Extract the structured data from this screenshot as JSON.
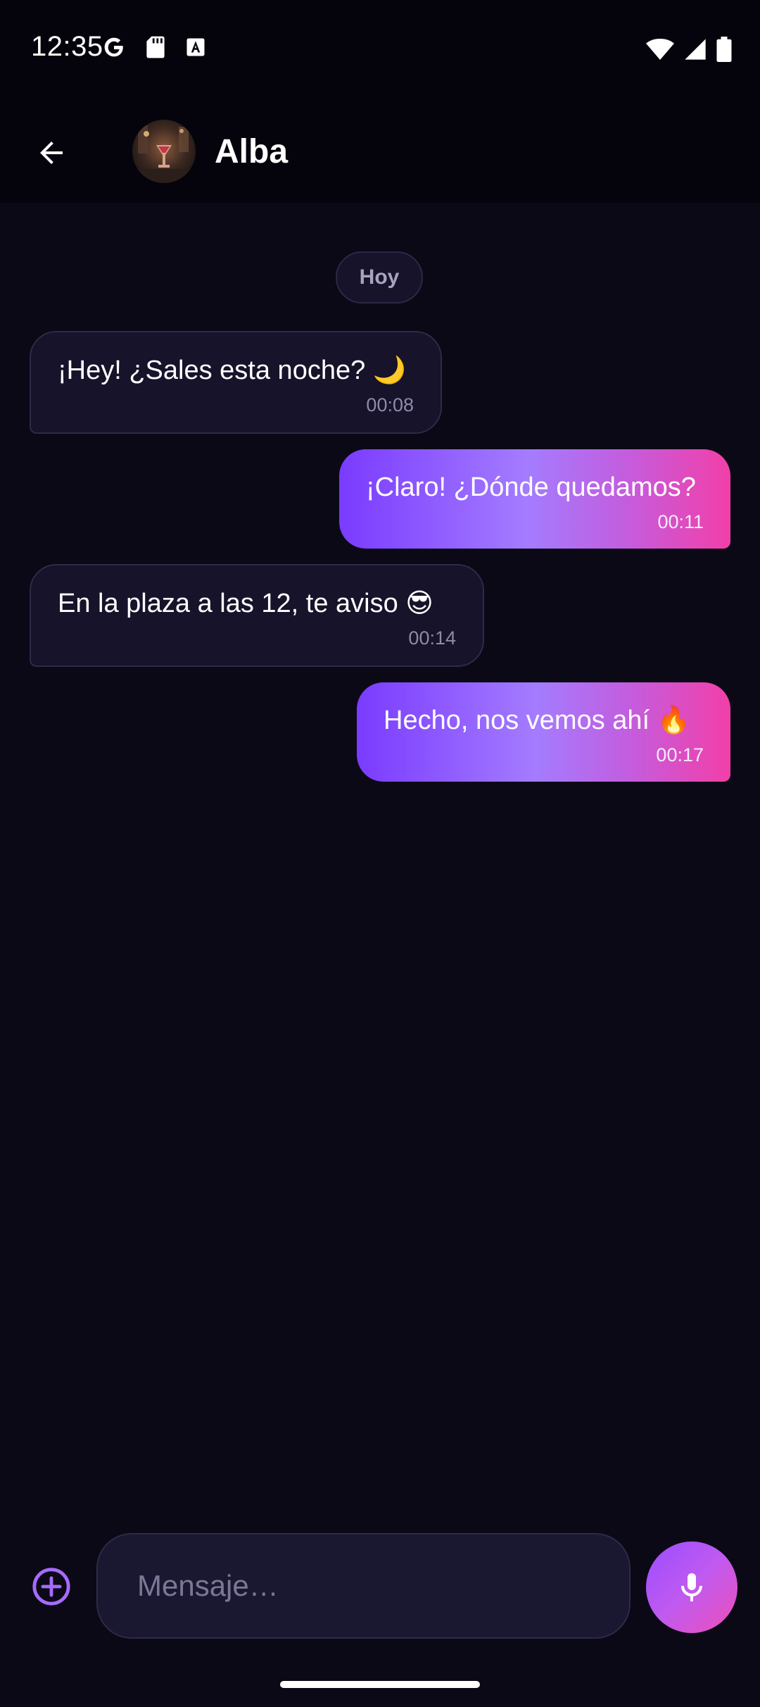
{
  "status_bar": {
    "time": "12:35",
    "left_icons": [
      "google-icon",
      "sd-card-icon",
      "font-icon"
    ],
    "right_icons": [
      "wifi-icon",
      "signal-icon",
      "battery-icon"
    ]
  },
  "header": {
    "back_icon": "arrow-back-icon",
    "contact_name": "Alba"
  },
  "chat": {
    "date_label": "Hoy",
    "messages": [
      {
        "direction": "incoming",
        "text": "¡Hey! ¿Sales esta noche? 🌙",
        "time": "00:08"
      },
      {
        "direction": "outgoing",
        "text": "¡Claro! ¿Dónde quedamos?",
        "time": "00:11"
      },
      {
        "direction": "incoming",
        "text": "En la plaza a las 12, te aviso 😎",
        "time": "00:14"
      },
      {
        "direction": "outgoing",
        "text": "Hecho, nos vemos ahí 🔥",
        "time": "00:17"
      }
    ]
  },
  "composer": {
    "add_icon": "plus-circle-icon",
    "placeholder": "Mensaje…",
    "mic_icon": "microphone-icon"
  },
  "colors": {
    "background": "#0b0916",
    "bar_background": "#05040c",
    "incoming_bubble": "#16132a",
    "outgoing_gradient_start": "#7a3bff",
    "outgoing_gradient_end": "#f23fa8",
    "accent": "#a66bff"
  }
}
